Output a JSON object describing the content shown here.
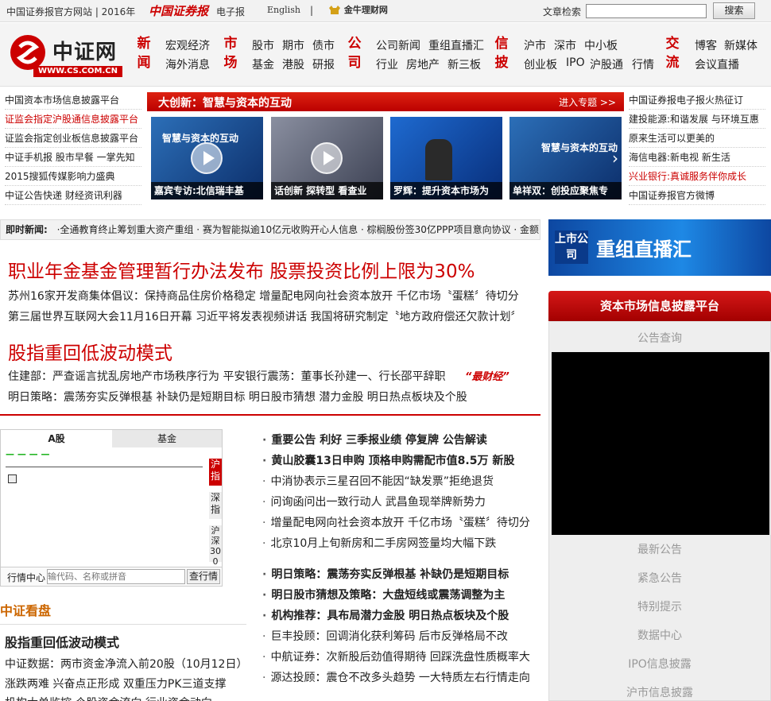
{
  "topbar": {
    "official_site": "中国证券报官方网站 | 2016年",
    "brand_mark": "中国证券报",
    "epaper": "电子报",
    "english": "English",
    "separator": "|",
    "jnlc_logo": "金牛理财网",
    "search_label": "文章检索",
    "search_placeholder": "",
    "search_button": "搜索"
  },
  "logo": {
    "name": "中证网",
    "url_text": "WWW.CS.COM.CN"
  },
  "nav": [
    {
      "category": "新闻",
      "links": [
        "宏观经济",
        "海外消息"
      ]
    },
    {
      "category": "市场",
      "links": [
        "股市",
        "期市",
        "债市",
        "基金",
        "港股",
        "研报"
      ]
    },
    {
      "category": "公司",
      "links": [
        "公司新闻",
        "重组直播汇",
        "行业",
        "房地产",
        "新三板"
      ]
    },
    {
      "category": "信披",
      "links": [
        "沪市",
        "深市",
        "中小板",
        "创业板",
        "IPO",
        "沪股通",
        "行情"
      ]
    },
    {
      "category": "交流",
      "links": [
        "博客",
        "新媒体",
        "会议直播"
      ]
    }
  ],
  "left_links": [
    "中国资本市场信息披露平台",
    "证监会指定沪股通信息披露平台",
    "证监会指定创业板信息披露平台",
    "中证手机报  股市早餐  一掌先知",
    "2015搜狐传媒影响力盛典",
    "中证公告快递  财经资讯利器"
  ],
  "right_links": [
    "中国证券报电子报火热征订",
    "建投能源:和谐发展 与环境互惠",
    "原来生活可以更美的",
    "海信电器:新电视 新生活",
    "兴业银行:真诚服务伴你成长",
    "中国证券报官方微博"
  ],
  "feature": {
    "title": "大创新：智慧与资本的互动",
    "enter": "进入专题 >>",
    "thumbs": [
      {
        "caption": "嘉宾专访:北信瑞丰基",
        "overlay": "智慧与资本的互动"
      },
      {
        "caption": "话创新  探转型  看查业",
        "overlay": ""
      },
      {
        "caption": "罗辉：提升资本市场为",
        "overlay": ""
      },
      {
        "caption": "单祥双：创投应聚焦专",
        "overlay": "智慧与资本的互动"
      }
    ]
  },
  "ticker": {
    "label": "即时新闻:",
    "text": "·全通教育终止筹划重大资产重组 · 赛为智能拟逾10亿元收购开心人信息 · 棕榈股份签30亿PPP项目意向协议 · 金额"
  },
  "headlines": [
    {
      "title": "职业年金基金管理暂行办法发布 股票投资比例上限为30%",
      "subs": [
        "苏州16家开发商集体倡议：保持商品住房价格稳定    增量配电网向社会资本放开  千亿市场〝蛋糕〞待切分",
        "第三届世界互联网大会11月16日开幕  习近平将发表视频讲话    我国将研究制定〝地方政府偿还欠款计划〞"
      ]
    },
    {
      "title": "股指重回低波动模式",
      "subs": [
        "住建部：严查谣言扰乱房地产市场秩序行为    平安银行震荡：董事长孙建一、行长邵平辞职",
        "明日策略：震荡夯实反弹根基  补缺仍是短期目标    明日股市猜想    潜力金股    明日热点板块及个股"
      ]
    }
  ],
  "zuicaijing": "“最财经”",
  "stock_widget": {
    "tabs": [
      "A股",
      "基金"
    ],
    "side_tabs": [
      "沪指",
      "深指",
      "沪深300"
    ],
    "dashes": "—  —  —  —",
    "center_label": "行情中心",
    "query_placeholder": "输代码、名称或拼音",
    "query_button": "查行情"
  },
  "kanpan": {
    "title": "中证看盘",
    "headline": "股指重回低波动模式",
    "items": [
      "中证数据：两市资金净流入前20股（10月12日）",
      "涨跌两难  兴奋点正形成  双重压力PK三道支撑",
      "机构大单监控  个股资金流向  行业资金动向"
    ]
  },
  "bullets_top": [
    {
      "text": "重要公告  利好  三季报业绩  停复牌  公告解读",
      "bold": true
    },
    {
      "text": "黄山胶囊13日申购  顶格申购需配市值8.5万  新股",
      "bold": true
    },
    {
      "text": "中消协表示三星召回不能因“缺发票”拒绝退货",
      "bold": false
    },
    {
      "text": "问询函问出一致行动人  武昌鱼现举牌新势力",
      "bold": false
    },
    {
      "text": "增量配电网向社会资本放开  千亿市场〝蛋糕〞待切分",
      "bold": false
    },
    {
      "text": "北京10月上旬新房和二手房网签量均大幅下跌",
      "bold": false
    }
  ],
  "bullets_bottom": [
    {
      "text": "明日策略：震荡夯实反弹根基  补缺仍是短期目标",
      "bold": true
    },
    {
      "text": "明日股市猜想及策略：大盘短线或震荡调整为主",
      "bold": true
    },
    {
      "text": "机构推荐：具布局潜力金股  明日热点板块及个股",
      "bold": true
    },
    {
      "text": "巨丰投顾：回调消化获利筹码  后市反弹格局不改",
      "bold": false
    },
    {
      "text": "中航证券：次新股后劲值得期待  回踩洗盘性质概率大",
      "bold": false
    },
    {
      "text": "源达投顾：震仓不改多头趋势  一大特质左右行情走向",
      "bold": false
    }
  ],
  "restructuring_banner": {
    "left": "上市公司",
    "right": "重组直播汇"
  },
  "disclosure": {
    "title": "资本市场信息披露平台",
    "items": [
      "公告查询",
      "最新公告",
      "紧急公告",
      "特别提示",
      "数据中心",
      "IPO信息披露",
      "沪市信息披露"
    ]
  },
  "colors": {
    "accent": "#cc0000",
    "banner_blue": "#1565c0",
    "panel_gray": "#eeeeee"
  }
}
